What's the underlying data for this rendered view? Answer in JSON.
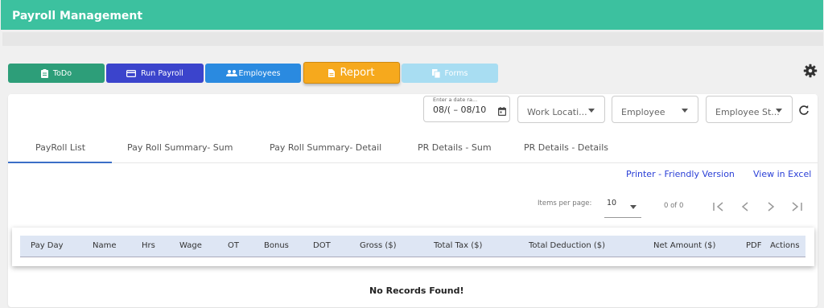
{
  "app": {
    "title": "Payroll Management"
  },
  "toolbar": {
    "todo": "ToDo",
    "run_payroll": "Run Payroll",
    "employees": "Employees",
    "report": "Report",
    "forms": "Forms"
  },
  "filters": {
    "date_label": "Enter a date ra...",
    "date_value": "08/( – 08/10",
    "work_location": "Work Locati...",
    "employee": "Employee",
    "employee_status": "Employee St..."
  },
  "tabs": [
    {
      "label": "PayRoll List"
    },
    {
      "label": "Pay Roll Summary- Sum"
    },
    {
      "label": "Pay Roll Summary- Detail"
    },
    {
      "label": "PR Details - Sum"
    },
    {
      "label": "PR Details - Details"
    }
  ],
  "links": {
    "printer": "Printer - Friendly Version",
    "excel": "View in Excel"
  },
  "pagination": {
    "items_per_page_label": "Items per page:",
    "items_per_page_value": "10",
    "range": "0 of 0"
  },
  "table": {
    "columns": [
      "Pay Day",
      "Name",
      "Hrs",
      "Wage",
      "OT",
      "Bonus",
      "DOT",
      "Gross ($)",
      "Total Tax ($)",
      "Total Deduction ($)",
      "Net Amount ($)",
      "PDF",
      "Actions"
    ],
    "empty_message": "No Records Found!"
  },
  "colors": {
    "header": "#3cc19f",
    "todo": "#2d9e79",
    "run_payroll": "#3b44cc",
    "employees": "#2a8ae0",
    "report": "#f6a91d",
    "forms": "#a8ddf2",
    "link": "#2a3fd6"
  }
}
